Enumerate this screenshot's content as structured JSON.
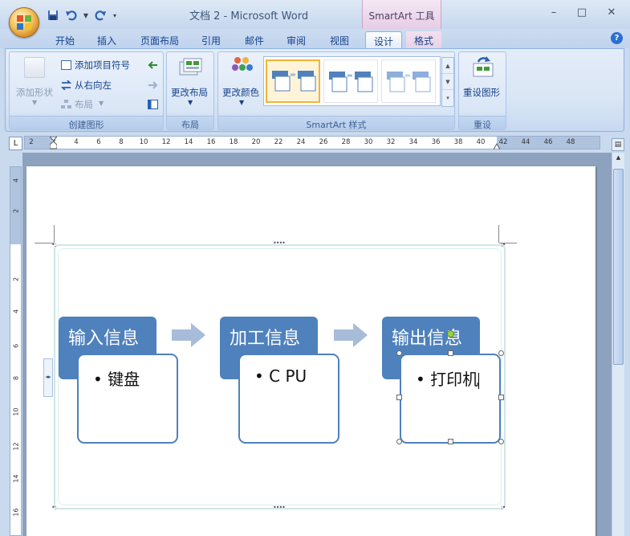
{
  "window": {
    "title": "文档 2 - Microsoft Word",
    "context_tab_title": "SmartArt 工具",
    "controls": [
      "–",
      "□",
      "✕"
    ]
  },
  "qat": {
    "save_icon": "save-icon",
    "undo_icon": "undo-icon",
    "redo_icon": "redo-icon"
  },
  "tabs": [
    "开始",
    "插入",
    "页面布局",
    "引用",
    "邮件",
    "审阅",
    "视图",
    "设计",
    "格式"
  ],
  "active_tab": "设计",
  "help": "?",
  "ribbon": {
    "create_graphic": {
      "label": "创建图形",
      "add_shape": "添加形状",
      "add_bullet": "添加项目符号",
      "right_to_left": "从右向左",
      "layout": "布局"
    },
    "layouts": {
      "label": "布局",
      "change_layout": "更改布局"
    },
    "styles": {
      "label": "SmartArt 样式",
      "change_colors": "更改颜色"
    },
    "reset": {
      "label": "重设",
      "reset_graphic": "重设图形"
    }
  },
  "ruler": {
    "h_numbers": [
      "2",
      "2",
      "4",
      "6",
      "8",
      "10",
      "12",
      "14",
      "16",
      "18",
      "20",
      "22",
      "24",
      "26",
      "28",
      "30",
      "32",
      "34",
      "36",
      "38",
      "40",
      "42",
      "44",
      "46",
      "48"
    ],
    "v_numbers": [
      "4",
      "2",
      "2",
      "4",
      "6",
      "8",
      "10",
      "12",
      "14",
      "16"
    ],
    "tab_selector": "L"
  },
  "smartart": {
    "steps": [
      {
        "heading": "输入信息",
        "bullet": "键盘"
      },
      {
        "heading": "加工信息",
        "bullet": "C PU"
      },
      {
        "heading": "输出信息",
        "bullet": "打印机"
      }
    ],
    "colors": {
      "accent": "#4f81bd",
      "arrow": "#a6bcd9"
    }
  }
}
